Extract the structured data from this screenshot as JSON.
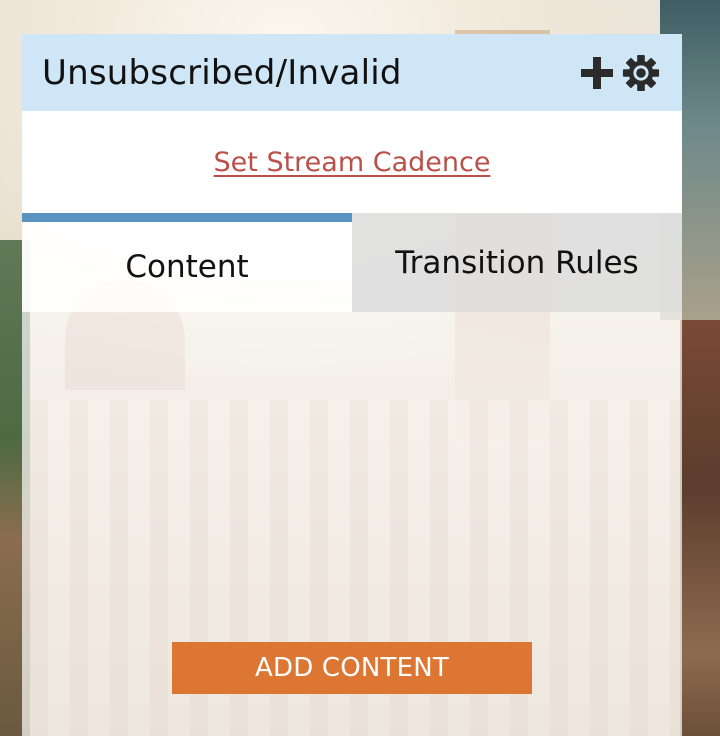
{
  "panel": {
    "title": "Unsubscribed/Invalid",
    "actions": [
      {
        "icon": "plus-icon"
      },
      {
        "icon": "gear-icon"
      }
    ]
  },
  "cadence": {
    "link_label": "Set Stream Cadence"
  },
  "tabs": [
    {
      "label": "Content",
      "active": true
    },
    {
      "label": "Transition Rules",
      "active": false
    }
  ],
  "content": {
    "add_button_label": "ADD CONTENT"
  },
  "colors": {
    "header_bg": "#cfe6f6",
    "link": "#b9514a",
    "active_tab_accent": "#5a93c0",
    "inactive_tab_bg": "#e0e0e0",
    "add_button": "#dc7632"
  }
}
